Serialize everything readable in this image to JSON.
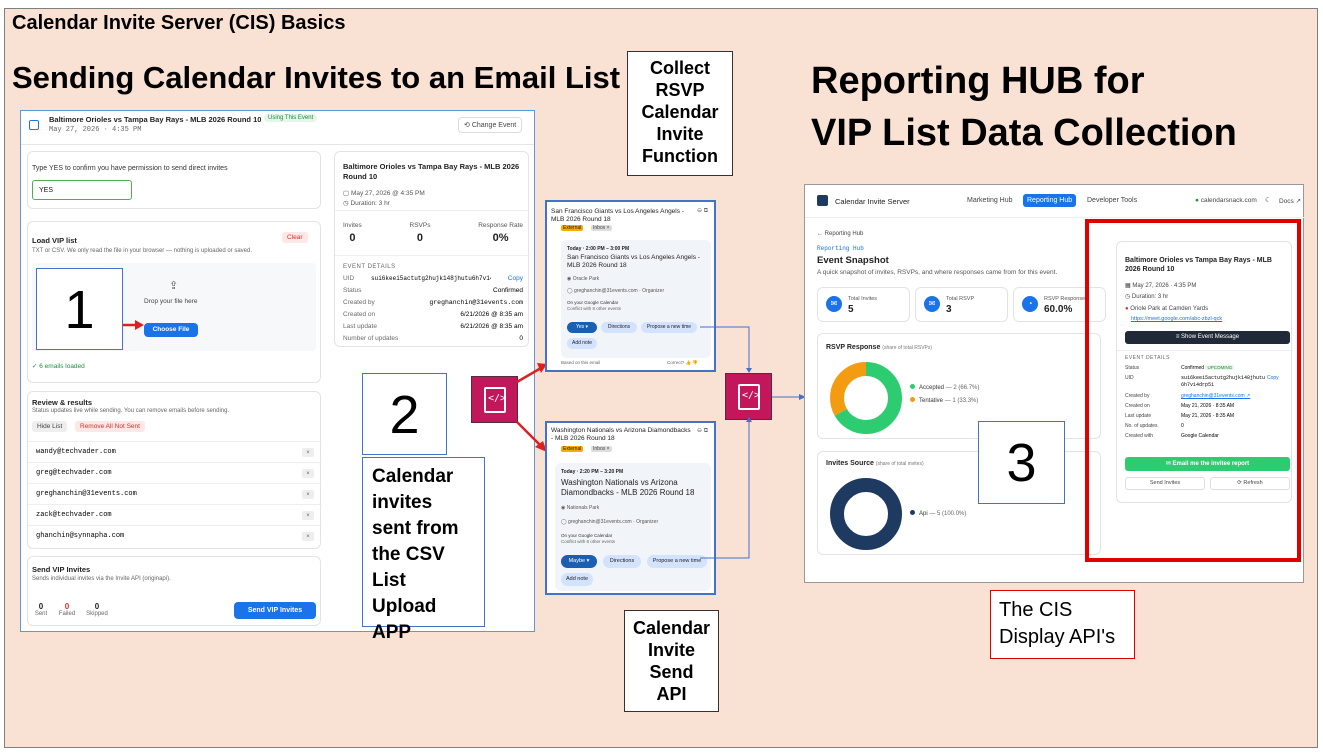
{
  "titles": {
    "top": "Calendar Invite Server (CIS) Basics",
    "sending": "Sending Calendar Invites to an Email List",
    "hub_line1": "Reporting HUB for",
    "hub_line2": "VIP List Data Collection"
  },
  "labels": {
    "collect": [
      "Collect",
      "RSVP",
      "Calendar",
      "Invite",
      "Function"
    ],
    "send_api": [
      "Calendar",
      "Invite",
      "Send",
      "API"
    ],
    "sent_from": [
      "Calendar",
      "invites",
      "sent from",
      "the CSV",
      "List Upload",
      "APP"
    ],
    "display_api": [
      "The CIS",
      "Display API's"
    ],
    "step1": "1",
    "step2": "2",
    "step3": "3"
  },
  "upload_app": {
    "event_title": "Baltimore Orioles vs Tampa Bay Rays - MLB 2026 Round 10",
    "event_badge": "Using This Event",
    "event_date": "May 27, 2026 · 4:35 PM",
    "change_event": "Change Event",
    "confirm_prompt": "Type YES to confirm you have permission to send direct invites",
    "confirm_value": "YES",
    "load_vip": "Load VIP list",
    "load_vip_desc": "TXT or CSV. We only read the file in your browser — nothing is uploaded or saved.",
    "clear": "Clear",
    "drop_here": "Drop your file here",
    "choose_file": "Choose File",
    "emails_loaded": "✓ 6 emails loaded",
    "review_title": "Review & results",
    "review_desc": "Status updates live while sending. You can remove emails before sending.",
    "hide_list": "Hide List",
    "remove_all": "Remove All Not Sent",
    "emails": [
      "wandy@techvader.com",
      "greg@techvader.com",
      "greghanchin@31events.com",
      "zack@techvader.com",
      "ghanchin@synnapha.com"
    ],
    "send_vip_title": "Send VIP Invites",
    "send_vip_desc": "Sends individual invites via the Invite API (originapi).",
    "send_vip_button": "Send VIP Invites",
    "stats": [
      {
        "value": "0",
        "label": "Sent"
      },
      {
        "value": "0",
        "label": "Failed"
      },
      {
        "value": "0",
        "label": "Skipped"
      }
    ],
    "detail_title": "Baltimore Orioles vs Tampa Bay Rays - MLB 2026 Round 10",
    "detail_date": "May 27, 2026 @ 4:35 PM",
    "detail_duration": "Duration: 3 hr",
    "metrics": [
      {
        "label": "Invites",
        "value": "0"
      },
      {
        "label": "RSVPs",
        "value": "0"
      },
      {
        "label": "Response Rate",
        "value": "0%"
      }
    ],
    "event_details_label": "EVENT DETAILS",
    "details": [
      {
        "k": "UID",
        "v": "sui6keei5actutg2hujk148jhutu6h7v14d…"
      },
      {
        "k": "Status",
        "v": "Confirmed"
      },
      {
        "k": "Created by",
        "v": "greghanchin@31events.com"
      },
      {
        "k": "Created on",
        "v": "6/21/2026 @ 8:35 am"
      },
      {
        "k": "Last update",
        "v": "6/21/2026 @ 8:35 am"
      },
      {
        "k": "Number of updates",
        "v": "0"
      }
    ],
    "copy": "Copy"
  },
  "invite1": {
    "title": "San Francisco Giants vs Los Angeles Angels - MLB 2026 Round 18",
    "tags": [
      "External",
      "Inbox ×"
    ],
    "time": "Today · 2:00 PM – 3:00 PM",
    "body_title": "San Francisco Giants vs Los Angeles Angels - MLB 2026 Round 18",
    "place": "Oracle Park",
    "organizer": "greghanchin@31events.com · Organizer",
    "calendar": "On your Google Calendar",
    "conflict": "Conflict with 8 other events",
    "rsvp": "Yes",
    "directions": "Directions",
    "propose": "Propose a new time",
    "add_note": "Add note",
    "footer": "Based on this email",
    "correct": "Correct?"
  },
  "invite2": {
    "title": "Washington Nationals vs Arizona Diamondbacks - MLB 2026 Round 18",
    "tags": [
      "External",
      "Inbox ×"
    ],
    "time": "Today · 2:20 PM – 3:20 PM",
    "body_title": "Washington Nationals vs Arizona Diamondbacks - MLB 2026 Round 18",
    "place": "Nationals Park",
    "organizer": "greghanchin@31events.com · Organizer",
    "calendar": "On your Google Calendar",
    "conflict": "Conflict with 8 other events",
    "rsvp": "Maybe",
    "directions": "Directions",
    "propose": "Propose a new time",
    "add_note": "Add note"
  },
  "hub": {
    "brand": "Calendar Invite Server",
    "nav": [
      "Marketing Hub",
      "Reporting Hub",
      "Developer Tools"
    ],
    "domain": "calendarsnack.com",
    "docs": "Docs ↗",
    "back": "← Reporting Hub",
    "breadcrumb": "Reporting Hub",
    "heading": "Event Snapshot",
    "subheading": "A quick snapshot of invites, RSVPs, and where responses came from for this event.",
    "tiles": [
      {
        "label": "Total Invites",
        "value": "5"
      },
      {
        "label": "Total RSVP",
        "value": "3"
      },
      {
        "label": "RSVP Response",
        "value": "60.0%"
      }
    ],
    "rsvp_title": "RSVP Response",
    "rsvp_sub": "(share of total RSVPs)",
    "rsvp_legend": [
      {
        "label": "Accepted",
        "value": "— 2 (66.7%)",
        "color": "#2ecc71"
      },
      {
        "label": "Tentative",
        "value": "— 1 (33.3%)",
        "color": "#f39c12"
      }
    ],
    "source_title": "Invites Source",
    "source_sub": "(share of total invites)",
    "source_legend": [
      {
        "label": "Api",
        "value": "— 5 (100.0%)",
        "color": "#1f3a60"
      }
    ],
    "panel_title": "Baltimore Orioles vs Tampa Bay Rays - MLB 2026 Round 10",
    "panel_date": "May 27, 2026 · 4:35 PM",
    "panel_duration": "Duration: 3 hr",
    "panel_place": "Oriole Park at Camden Yards",
    "panel_link": "https://meet.google.com/abc-zbzl-qck",
    "show_message": "≡ Show Event Message",
    "event_details_label": "EVENT DETAILS",
    "details": [
      {
        "k": "Status",
        "v": "Confirmed"
      },
      {
        "k": "UID",
        "v": "sui6keei5actutg2hujk148jhutu6h7v14drp51"
      },
      {
        "k": "Created by",
        "v": "greghanchin@31events.com ↗"
      },
      {
        "k": "Created on",
        "v": "May 21, 2026 · 8:35 AM"
      },
      {
        "k": "Last update",
        "v": "May 21, 2026 · 8:35 AM"
      },
      {
        "k": "No. of updates",
        "v": "0"
      },
      {
        "k": "Created with",
        "v": "Google Calendar"
      }
    ],
    "status_badge": "UPCOMING",
    "copy": "Copy",
    "email_report": "✉ Email me the invitee report",
    "send_invites": "Send Invites",
    "refresh": "⟳ Refresh"
  },
  "chart_data": [
    {
      "type": "pie",
      "title": "RSVP Response",
      "categories": [
        "Accepted",
        "Tentative"
      ],
      "values": [
        2,
        1
      ],
      "colors": [
        "#2ecc71",
        "#f39c12"
      ]
    },
    {
      "type": "pie",
      "title": "Invites Source",
      "categories": [
        "Api"
      ],
      "values": [
        5
      ],
      "colors": [
        "#1f3a60"
      ]
    }
  ]
}
